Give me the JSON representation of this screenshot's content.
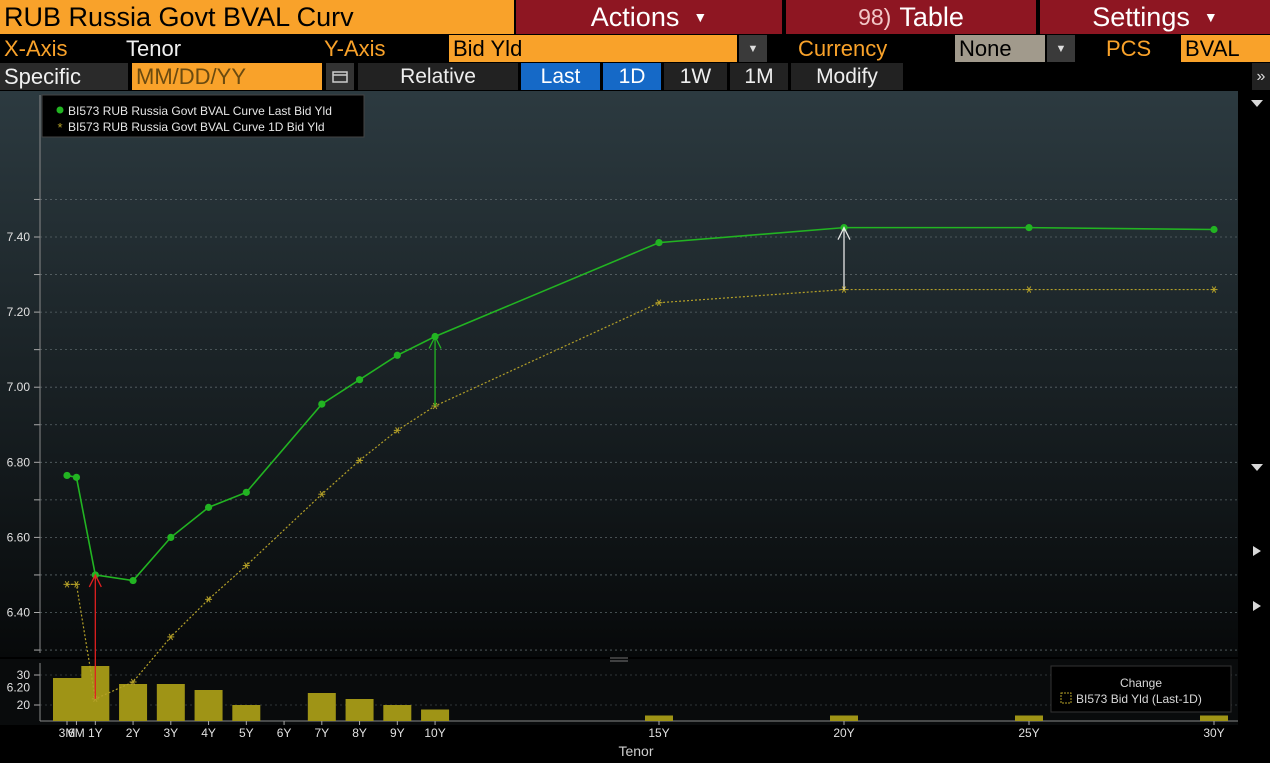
{
  "header": {
    "title": "RUB Russia Govt BVAL Curv",
    "actions_label": "Actions",
    "table_num": "98)",
    "table_label": "Table",
    "settings_label": "Settings"
  },
  "axis_row": {
    "x_axis_label": "X-Axis",
    "x_axis_value": "Tenor",
    "y_axis_label": "Y-Axis",
    "y_axis_value": "Bid Yld",
    "currency_label": "Currency",
    "currency_value": "None",
    "pcs_label": "PCS",
    "pcs_value": "BVAL"
  },
  "date_row": {
    "specific_label": "Specific",
    "date_placeholder": "MM/DD/YY",
    "relative_label": "Relative",
    "buttons": [
      "Last",
      "1D",
      "1W",
      "1M",
      "Modify"
    ],
    "more_icon": "»"
  },
  "icons": {
    "calendar": "calendar-icon",
    "scroll_down": "triangle-down-icon",
    "scroll_right": "triangle-right-icon"
  },
  "colors": {
    "accent_orange": "#f9a22a",
    "header_red": "#8e1622",
    "active_blue": "#1569c7",
    "series_last": "#22b422",
    "series_1d": "#b4a028",
    "bars": "#9f9416"
  },
  "chart_data": {
    "type": "line",
    "x": [
      "3M",
      "6M",
      "1Y",
      "2Y",
      "3Y",
      "4Y",
      "5Y",
      "6Y",
      "7Y",
      "8Y",
      "9Y",
      "10Y",
      "15Y",
      "20Y",
      "25Y",
      "30Y"
    ],
    "xlabel": "Tenor",
    "ylim": [
      6.1,
      7.5
    ],
    "yticks": [
      "6.20",
      "6.40",
      "6.60",
      "6.80",
      "7.00",
      "7.20",
      "7.40"
    ],
    "grid": true,
    "legend_position": "top-left",
    "series": [
      {
        "name": "BI573 RUB Russia Govt BVAL Curve Last Bid Yld",
        "marker": "dot",
        "values": [
          6.765,
          6.76,
          6.5,
          6.485,
          6.6,
          6.68,
          6.72,
          null,
          6.955,
          7.02,
          7.085,
          7.135,
          7.385,
          7.425,
          7.425,
          7.42
        ]
      },
      {
        "name": "BI573 RUB Russia Govt BVAL Curve 1D Bid Yld",
        "marker": "star",
        "values": [
          6.475,
          6.475,
          6.17,
          6.215,
          6.335,
          6.435,
          6.525,
          null,
          6.715,
          6.805,
          6.885,
          6.95,
          7.225,
          7.26,
          7.26,
          7.26
        ]
      }
    ],
    "change_arrows": [
      "1Y",
      "10Y",
      "20Y"
    ],
    "change_panel": {
      "title": "Change",
      "legend": "BI573 Bid Yld (Last-1D)",
      "yticks": [
        "20",
        "30"
      ],
      "ylim": [
        15,
        34
      ],
      "values": [
        29,
        29,
        33,
        27,
        27,
        25,
        20,
        null,
        24,
        22,
        20,
        18.5,
        16.5,
        16.5,
        16.5,
        16.5
      ]
    }
  }
}
